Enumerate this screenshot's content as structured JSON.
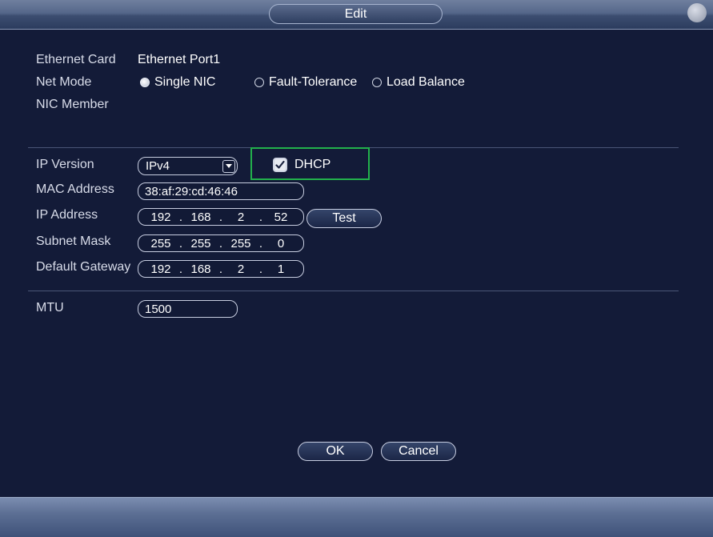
{
  "window": {
    "title": "Edit"
  },
  "network": {
    "ethernet_card_label": "Ethernet Card",
    "ethernet_card_value": "Ethernet Port1",
    "net_mode_label": "Net Mode",
    "net_mode_options": [
      "Single NIC",
      "Fault-Tolerance",
      "Load Balance"
    ],
    "net_mode_selected": "Single NIC",
    "nic_member_label": "NIC Member"
  },
  "ip": {
    "ip_version_label": "IP Version",
    "ip_version_value": "IPv4",
    "dhcp_label": "DHCP",
    "dhcp_checked": true,
    "mac_label": "MAC Address",
    "mac_value": "38:af:29:cd:46:46",
    "ip_label": "IP Address",
    "ip_octets": [
      "192",
      "168",
      "2",
      "52"
    ],
    "test_label": "Test",
    "subnet_label": "Subnet Mask",
    "subnet_octets": [
      "255",
      "255",
      "255",
      "0"
    ],
    "gateway_label": "Default Gateway",
    "gateway_octets": [
      "192",
      "168",
      "2",
      "1"
    ],
    "octet_separator": "."
  },
  "mtu": {
    "label": "MTU",
    "value": "1500"
  },
  "actions": {
    "ok_label": "OK",
    "cancel_label": "Cancel"
  },
  "colors": {
    "background": "#131b38",
    "highlight": "#22b14c"
  }
}
